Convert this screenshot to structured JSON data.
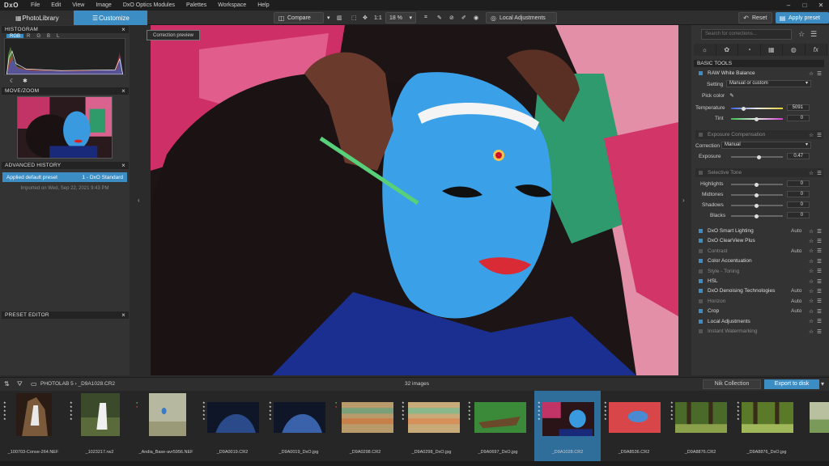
{
  "menu": {
    "logo": "DxO",
    "items": [
      "File",
      "Edit",
      "View",
      "Image",
      "DxO Optics Modules",
      "Palettes",
      "Workspace",
      "Help"
    ]
  },
  "toolbar": {
    "tab_photolibrary": "PhotoLibrary",
    "tab_customize": "Customize",
    "compare": "Compare",
    "one_to_one": "1:1",
    "zoom": "18 %",
    "local_adjustments": "Local Adjustments",
    "reset": "Reset",
    "apply_preset": "Apply preset"
  },
  "left": {
    "histogram_title": "HISTOGRAM",
    "channels": [
      "RGB",
      "R",
      "G",
      "B",
      "L"
    ],
    "movezoom_title": "MOVE/ZOOM",
    "history_title": "ADVANCED HISTORY",
    "history_item": "Applied default preset",
    "history_preset": "1 - DxO Standard",
    "history_date": "Imported on Wed, Sep 22, 2021 9:43 PM",
    "preset_editor_title": "PRESET EDITOR"
  },
  "viewer": {
    "correction_preview": "Correction preview"
  },
  "right": {
    "search_placeholder": "Search for corrections...",
    "basic_tools": "BASIC TOOLS",
    "white_balance": "RAW White Balance",
    "setting_label": "Setting",
    "setting_value": "Manual or custom",
    "pick_color": "Pick color",
    "temperature_label": "Temperature",
    "temperature_value": "5091",
    "tint_label": "Tint",
    "tint_value": "0",
    "exposure_comp": "Exposure Compensation",
    "correction_label": "Correction",
    "correction_value": "Manual",
    "exposure_label": "Exposure",
    "exposure_value": "0.47",
    "selective_tone": "Selective Tone",
    "highlights": "Highlights",
    "highlights_value": "0",
    "midtones": "Midtones",
    "midtones_value": "0",
    "shadows": "Shadows",
    "shadows_value": "0",
    "blacks": "Blacks",
    "blacks_value": "0",
    "tools": [
      {
        "label": "DxO Smart Lighting",
        "auto": "Auto",
        "on": true
      },
      {
        "label": "DxO ClearView Plus",
        "auto": "",
        "on": true
      },
      {
        "label": "Contrast",
        "auto": "Auto",
        "on": false
      },
      {
        "label": "Color Accentuation",
        "auto": "",
        "on": true
      },
      {
        "label": "Style - Toning",
        "auto": "",
        "on": false
      },
      {
        "label": "HSL",
        "auto": "",
        "on": true
      },
      {
        "label": "DxO Denoising Technologies",
        "auto": "Auto",
        "on": true
      },
      {
        "label": "Horizon",
        "auto": "Auto",
        "on": false
      },
      {
        "label": "Crop",
        "auto": "Auto",
        "on": true
      },
      {
        "label": "Local Adjustments",
        "auto": "",
        "on": true
      },
      {
        "label": "Instant Watermarking",
        "auto": "",
        "on": false
      }
    ]
  },
  "strip": {
    "path_root": "PHOTOLAB 5",
    "path_current": "_D9A1028.CR2",
    "count": "32 images",
    "nik": "Nik Collection",
    "export": "Export to disk",
    "files": [
      "_100703-Conse-264.NEF",
      "_1023217.rw2",
      "_Andia_Base-avr5956.NEF",
      "_D9A0019.CR2",
      "_D9A0019_DxO.jpg",
      "_D9A0298.CR2",
      "_D9A0298_DxO.jpg",
      "_D9A0697_DxO.jpg",
      "_D9A1028.CR2",
      "_D9A8536.CR2",
      "_D9A8876.CR2",
      "_D9A8876_DxO.jpg"
    ]
  }
}
